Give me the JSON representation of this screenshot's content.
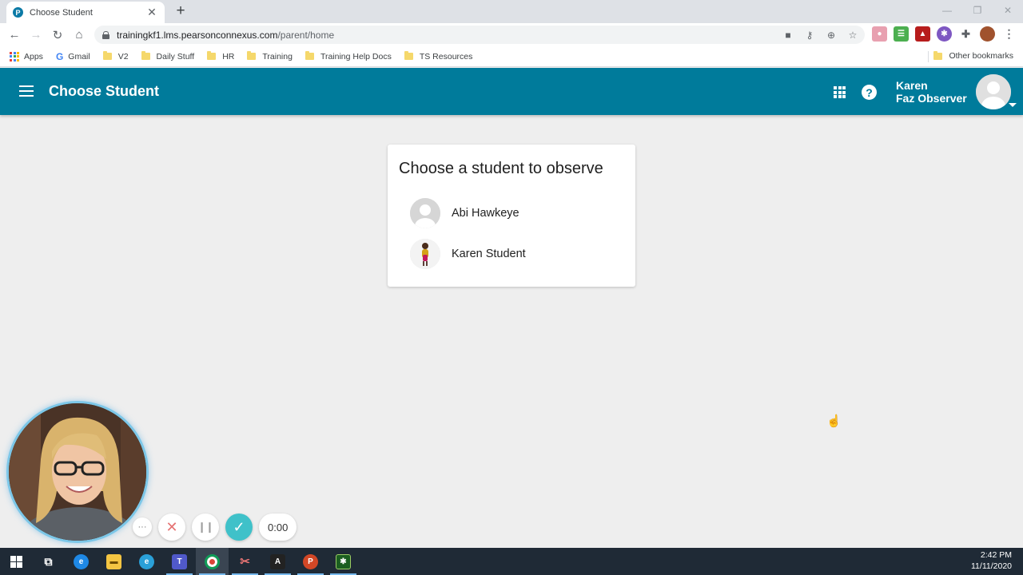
{
  "browser": {
    "tab_title": "Choose Student",
    "favicon_letter": "P",
    "url_host": "trainingkf1.lms.pearsonconnexus.com",
    "url_path": "/parent/home",
    "bookmarks": [
      {
        "label": "Apps",
        "type": "apps"
      },
      {
        "label": "Gmail",
        "type": "google"
      },
      {
        "label": "V2",
        "type": "folder"
      },
      {
        "label": "Daily Stuff",
        "type": "folder"
      },
      {
        "label": "HR",
        "type": "folder"
      },
      {
        "label": "Training",
        "type": "folder"
      },
      {
        "label": "Training Help Docs",
        "type": "folder"
      },
      {
        "label": "TS Resources",
        "type": "folder"
      }
    ],
    "other_bookmarks": "Other bookmarks"
  },
  "header": {
    "title": "Choose Student",
    "user_first": "Karen",
    "user_last": "Faz Observer",
    "help_glyph": "?"
  },
  "card": {
    "title": "Choose a student to observe",
    "students": [
      {
        "name": "Abi Hawkeye",
        "avatar": "default"
      },
      {
        "name": "Karen Student",
        "avatar": "photo"
      }
    ]
  },
  "recorder": {
    "more_glyph": "···",
    "cancel_glyph": "✕",
    "pause_glyph": "❙❙",
    "done_glyph": "✓",
    "timer": "0:00"
  },
  "taskbar": {
    "time": "2:42 PM",
    "date": "11/11/2020"
  },
  "colors": {
    "header": "#007b9b",
    "background": "#eeeeee",
    "taskbar": "#1f2a36"
  }
}
